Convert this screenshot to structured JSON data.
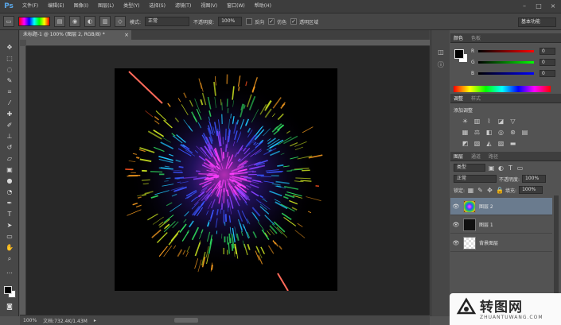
{
  "menubar": {
    "logo": "Ps",
    "items": [
      "文件(F)",
      "编辑(E)",
      "图像(I)",
      "图层(L)",
      "类型(Y)",
      "选择(S)",
      "滤镜(T)",
      "视图(V)",
      "窗口(W)",
      "帮助(H)"
    ],
    "controls": [
      "–",
      "□",
      "×"
    ]
  },
  "options": {
    "mode_label": "模式:",
    "mode_value": "正常",
    "opacity_label": "不透明度:",
    "opacity_value": "100%",
    "reverse_label": "反向",
    "dither_label": "仿色",
    "transparency_label": "透明区域",
    "workspace": "基本功能"
  },
  "document": {
    "tab_title": "未标题-1 @ 100% (图层 2, RGB/8) *",
    "close": "×",
    "zoom": "100%",
    "doc_info": "文档:732.4K/1.43M",
    "arrow": "▸"
  },
  "color_panel": {
    "tabs": [
      "颜色",
      "色板"
    ],
    "r_label": "R",
    "g_label": "G",
    "b_label": "B",
    "r_value": "0",
    "g_value": "0",
    "b_value": "0",
    "fg_color": "#000000",
    "bg_color": "#ffffff"
  },
  "adjust_panel": {
    "tabs": [
      "调整",
      "样式"
    ],
    "title": "添加调整"
  },
  "layers_panel": {
    "tabs": [
      "图层",
      "通道",
      "路径"
    ],
    "filter_label": "类型",
    "blend_mode": "正常",
    "opacity_label": "不透明度:",
    "opacity_value": "100%",
    "lock_label": "锁定:",
    "fill_label": "填充:",
    "fill_value": "100%",
    "layers": [
      {
        "name": "图层 2",
        "selected": true
      },
      {
        "name": "图层 1",
        "selected": false
      },
      {
        "name": "背景图层",
        "selected": false
      }
    ]
  },
  "watermark": {
    "title": "转图网",
    "subtitle": "ZHUANTUWANG.COM"
  },
  "colors": {
    "accent": "#5aa6e6",
    "selected_layer": "#6a7b8e"
  }
}
